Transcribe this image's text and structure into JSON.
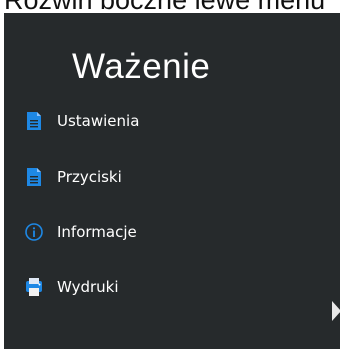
{
  "caption": {
    "text": "Rozwiń boczne lewe menu"
  },
  "screen": {
    "title": "Ważenie",
    "menu": [
      {
        "label": "Ustawienia",
        "icon": "document-icon"
      },
      {
        "label": "Przyciski",
        "icon": "document-icon"
      },
      {
        "label": "Informacje",
        "icon": "info-icon"
      },
      {
        "label": "Wydruki",
        "icon": "printer-icon"
      }
    ]
  },
  "colors": {
    "background": "#262a2c",
    "text": "#ffffff",
    "icon_blue": "#1e88e5"
  }
}
